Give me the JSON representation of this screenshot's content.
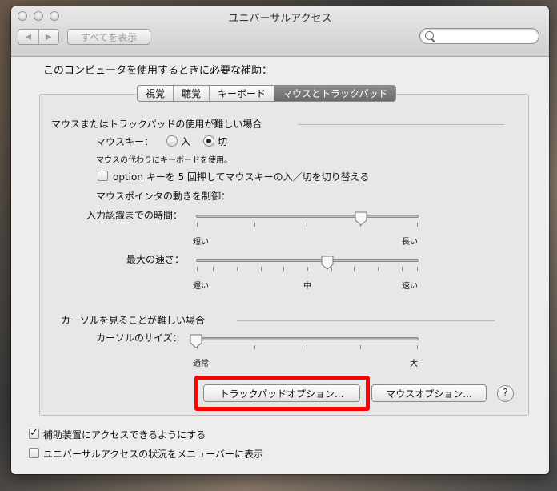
{
  "window": {
    "title": "ユニバーサルアクセス"
  },
  "toolbar": {
    "back_icon": "◀",
    "forward_icon": "▶",
    "show_all_label": "すべてを表示",
    "search_placeholder": ""
  },
  "heading": "このコンピュータを使用するときに必要な補助：",
  "tabs": [
    {
      "label": "視覚",
      "active": false
    },
    {
      "label": "聴覚",
      "active": false
    },
    {
      "label": "キーボード",
      "active": false
    },
    {
      "label": "マウスとトラックパッド",
      "active": true
    }
  ],
  "mouse_section": {
    "title": "マウスまたはトラックパッドの使用が難しい場合",
    "mouse_keys_label": "マウスキー：",
    "radio_on_label": "入",
    "radio_off_label": "切",
    "selected": "切",
    "mouse_keys_desc": "マウスの代わりにキーボードを使用。",
    "option_toggle_label": "option キーを 5 回押してマウスキーの入／切を切り替える",
    "option_toggle_checked": false,
    "pointer_control_label": "マウスポインタの動きを制御：",
    "delay_label": "入力認識までの時間：",
    "delay_min": "短い",
    "delay_max": "長い",
    "delay_value": 0.74,
    "speed_label": "最大の速さ：",
    "speed_min": "遅い",
    "speed_mid": "中",
    "speed_max": "速い",
    "speed_value": 0.59
  },
  "cursor_section": {
    "title": "カーソルを見ることが難しい場合",
    "size_label": "カーソルのサイズ：",
    "size_min": "通常",
    "size_max": "大",
    "size_value": 0.0
  },
  "buttons": {
    "trackpad_options": "トラックパッドオプション...",
    "mouse_options": "マウスオプション...",
    "help": "?"
  },
  "footer": {
    "enable_access_label": "補助装置にアクセスできるようにする",
    "enable_access_checked": true,
    "menubar_status_label": "ユニバーサルアクセスの状況をメニューバーに表示",
    "menubar_status_checked": false
  },
  "colors": {
    "highlight": "#ff0000",
    "active_tab": "#777777"
  }
}
